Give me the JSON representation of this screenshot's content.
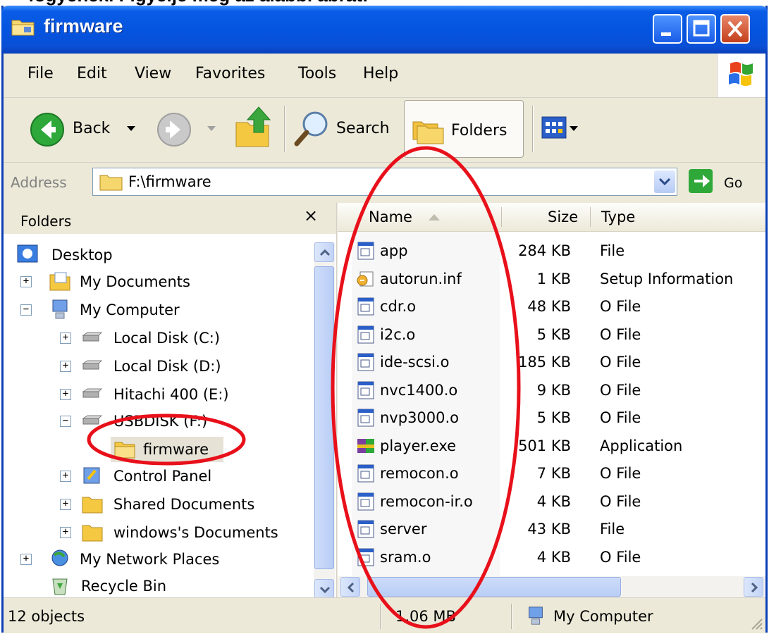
{
  "caption": "fogyéhek. Figyelje meg az alábbi ábrát:",
  "window": {
    "title": "firmware"
  },
  "menu": [
    "File",
    "Edit",
    "View",
    "Favorites",
    "Tools",
    "Help"
  ],
  "toolbar": {
    "back_label": "Back",
    "search_label": "Search",
    "folders_label": "Folders"
  },
  "address": {
    "label": "Address",
    "value": "F:\\firmware",
    "go_label": "Go"
  },
  "folders_pane": {
    "title": "Folders",
    "close_symbol": "×",
    "tree": [
      {
        "label": "Desktop",
        "expander": "",
        "icon": "desktop-icon"
      },
      {
        "label": "My Documents",
        "expander": "+",
        "icon": "my-documents-icon"
      },
      {
        "label": "My Computer",
        "expander": "−",
        "icon": "my-computer-icon"
      },
      {
        "label": "Local Disk (C:)",
        "expander": "+",
        "icon": "drive-icon"
      },
      {
        "label": "Local Disk (D:)",
        "expander": "+",
        "icon": "drive-icon"
      },
      {
        "label": "Hitachi 400 (E:)",
        "expander": "+",
        "icon": "drive-icon"
      },
      {
        "label": "USBDISK (F:)",
        "expander": "−",
        "icon": "drive-icon"
      },
      {
        "label": "firmware",
        "expander": "",
        "icon": "folder-icon"
      },
      {
        "label": "Control Panel",
        "expander": "+",
        "icon": "control-panel-icon"
      },
      {
        "label": "Shared Documents",
        "expander": "+",
        "icon": "folder-icon"
      },
      {
        "label": "windows's Documents",
        "expander": "+",
        "icon": "folder-icon"
      },
      {
        "label": "My Network Places",
        "expander": "+",
        "icon": "network-icon"
      },
      {
        "label": "Recycle Bin",
        "expander": "",
        "icon": "recycle-bin-icon"
      }
    ]
  },
  "columns": {
    "name": "Name",
    "size": "Size",
    "type": "Type"
  },
  "files": [
    {
      "name": "app",
      "size": "284 KB",
      "type": "File",
      "icon": "file-icon"
    },
    {
      "name": "autorun.inf",
      "size": "1 KB",
      "type": "Setup Information",
      "icon": "setup-info-icon"
    },
    {
      "name": "cdr.o",
      "size": "48 KB",
      "type": "O File",
      "icon": "file-icon"
    },
    {
      "name": "i2c.o",
      "size": "5 KB",
      "type": "O File",
      "icon": "file-icon"
    },
    {
      "name": "ide-scsi.o",
      "size": "185 KB",
      "type": "O File",
      "icon": "file-icon"
    },
    {
      "name": "nvc1400.o",
      "size": "9 KB",
      "type": "O File",
      "icon": "file-icon"
    },
    {
      "name": "nvp3000.o",
      "size": "5 KB",
      "type": "O File",
      "icon": "file-icon"
    },
    {
      "name": "player.exe",
      "size": "501 KB",
      "type": "Application",
      "icon": "application-icon"
    },
    {
      "name": "remocon.o",
      "size": "7 KB",
      "type": "O File",
      "icon": "file-icon"
    },
    {
      "name": "remocon-ir.o",
      "size": "4 KB",
      "type": "O File",
      "icon": "file-icon"
    },
    {
      "name": "server",
      "size": "43 KB",
      "type": "File",
      "icon": "file-icon"
    },
    {
      "name": "sram.o",
      "size": "4 KB",
      "type": "O File",
      "icon": "file-icon"
    }
  ],
  "status": {
    "objects": "12 objects",
    "size": "1,06 MB",
    "location": "My Computer"
  },
  "colors": {
    "title_bar": "#0454e0",
    "annotation_red": "#e8101a"
  }
}
